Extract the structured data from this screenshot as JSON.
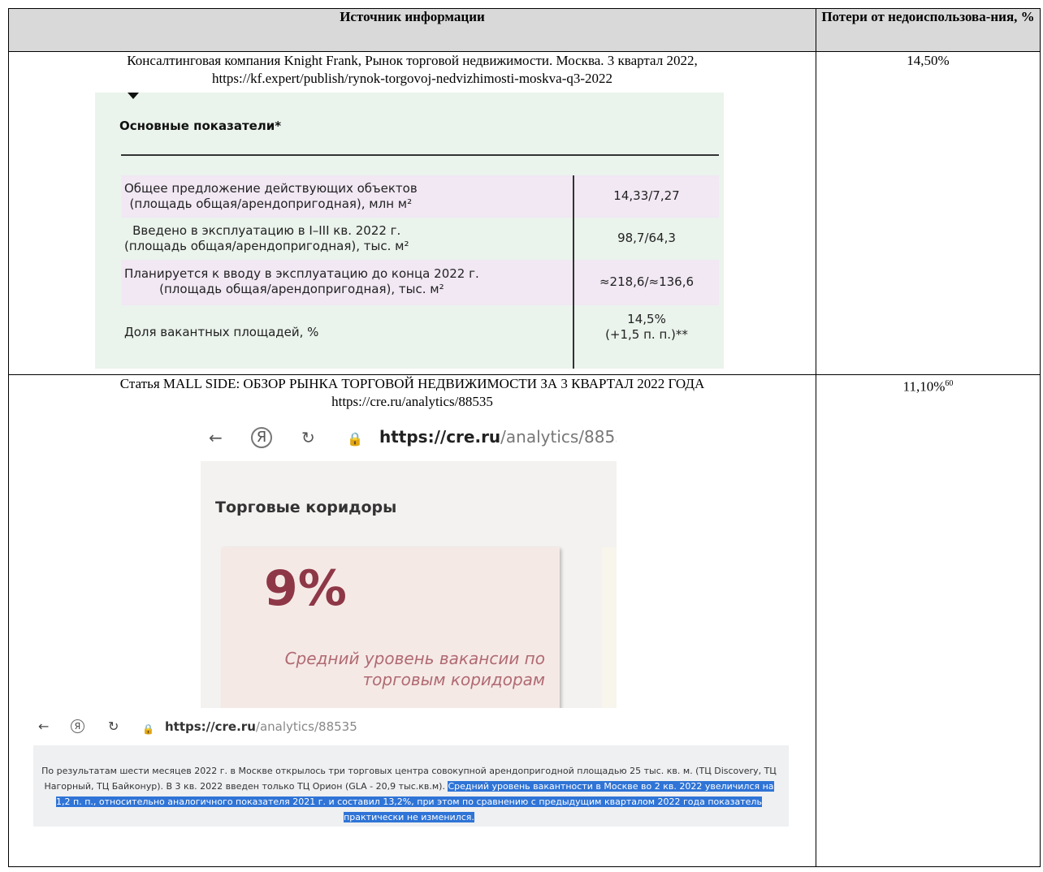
{
  "table": {
    "header_source": "Источник информации",
    "header_losses": "Потери от недоиспользова-ния, %"
  },
  "rows": [
    {
      "source_line1": "Консалтинговая компания Knight Frank, Рынок торговой недвижимости. Москва. 3 квартал 2022,",
      "source_line2": "https://kf.expert/publish/rynok-torgovoj-nedvizhimosti-moskva-q3-2022",
      "value": "14,50%"
    },
    {
      "source_line1": "Статья MALL SIDE: ОБЗОР РЫНКА ТОРГОВОЙ НЕДВИЖИМОСТИ ЗА 3 КВАРТАЛ 2022 ГОДА",
      "source_line2": "https://cre.ru/analytics/88535",
      "value": "11,10%",
      "footnote": "60"
    }
  ],
  "kf_screenshot": {
    "title": "Основные показатели*",
    "rows": [
      {
        "label1": "Общее предложение действующих объектов",
        "label2": "(площадь общая/арендопригодная), млн м²",
        "value1": "14,33/7,27",
        "value2": ""
      },
      {
        "label1": "Введено в эксплуатацию в I–III кв. 2022 г.",
        "label2": "(площадь общая/арендопригодная), тыс. м²",
        "value1": "98,7/64,3",
        "value2": ""
      },
      {
        "label1": "Планируется к вводу в эксплуатацию до конца 2022 г.",
        "label2": "(площадь общая/арендопригодная), тыс. м²",
        "value1": "≈218,6/≈136,6",
        "value2": ""
      },
      {
        "label1": "Доля вакантных площадей, %",
        "label2": "",
        "value1": "14,5%",
        "value2": "(+1,5 п. п.)**"
      }
    ]
  },
  "cre_screenshot_1": {
    "url_host": "https://cre.ru",
    "url_path": "/analytics/88535",
    "heading": "Торговые коридоры",
    "big_value": "9%",
    "caption_line1": "Средний уровень вакансии по",
    "caption_line2": "торговым коридорам"
  },
  "cre_screenshot_2": {
    "url_host": "https://cre.ru",
    "url_path": "/analytics/88535",
    "text_plain": "По результатам шести месяцев 2022 г. в Москве открылось три торговых центра совокупной арендопригодной площадью 25 тыс. кв. м. (ТЦ Discovery, ТЦ Нагорный, ТЦ Байконур). В 3 кв. 2022 введен только ТЦ Орион (GLA - 20,9 тыс.кв.м). ",
    "text_highlight": "Средний уровень вакантности в Москве во 2 кв. 2022 увеличился на 1,2 п. п., относительно аналогичного показателя 2021 г. и составил 13,2%, при этом по сравнению с предыдущим кварталом 2022 года показатель практически не изменился."
  },
  "colors": {
    "header_bg": "#d9d9d9",
    "kf_bg": "#eaf3ec",
    "kf_row_pink": "#f1e8f4",
    "cre_accent": "#8e3747",
    "highlight": "#2f74d6"
  }
}
